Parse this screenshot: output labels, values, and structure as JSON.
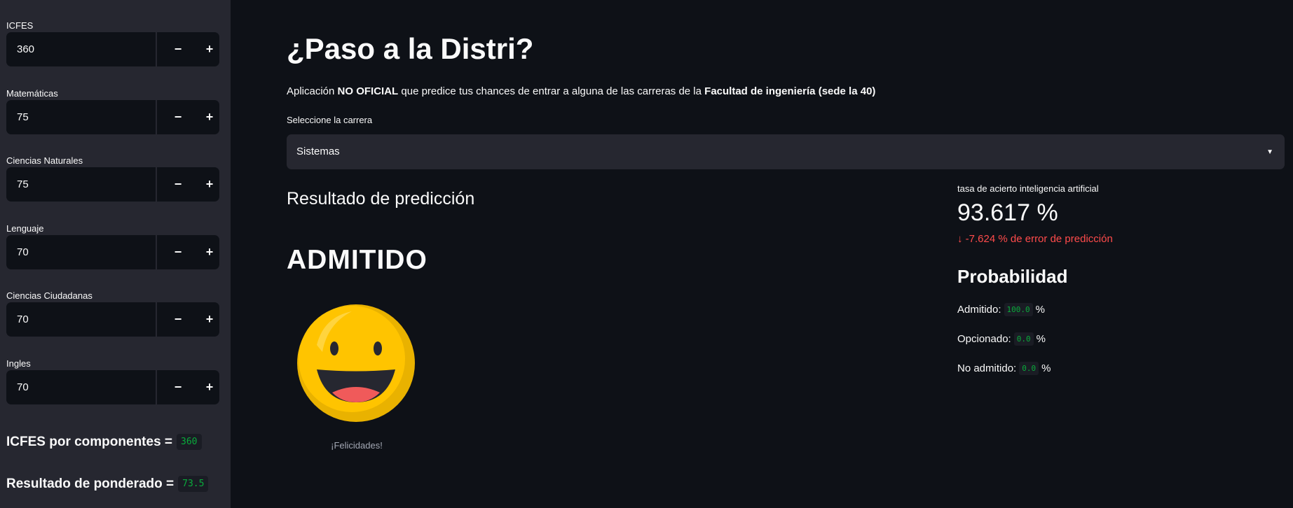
{
  "sidebar": {
    "fields": [
      {
        "label": "ICFES",
        "value": "360"
      },
      {
        "label": "Matemáticas",
        "value": "75"
      },
      {
        "label": "Ciencias Naturales",
        "value": "75"
      },
      {
        "label": "Lenguaje",
        "value": "70"
      },
      {
        "label": "Ciencias Ciudadanas",
        "value": "70"
      },
      {
        "label": "Ingles",
        "value": "70"
      }
    ],
    "step_minus": "−",
    "step_plus": "+",
    "icfes_components_label": "ICFES por componentes =",
    "icfes_components_value": "360",
    "weighted_label": "Resultado de ponderado =",
    "weighted_value": "73.5"
  },
  "main": {
    "title": "¿Paso a la Distri?",
    "subtitle_prefix": "Aplicación ",
    "subtitle_bold1": "NO OFICIAL",
    "subtitle_middle": " que predice tus chances de entrar a alguna de las carreras de la ",
    "subtitle_bold2": "Facultad de ingeniería (sede la 40)",
    "select_label": "Seleccione la carrera",
    "select_value": "Sistemas",
    "result_heading": "Resultado de predicción",
    "result": "ADMITIDO",
    "smiley_icon": "smiling-face-icon",
    "caption": "¡Felicidades!"
  },
  "metrics": {
    "label": "tasa de acierto inteligencia artificial",
    "value": "93.617 %",
    "delta": "-7.624 % de error de predicción",
    "delta_arrow": "↓",
    "delta_color": "#ff4b4b"
  },
  "probability": {
    "heading": "Probabilidad",
    "rows": [
      {
        "label": "Admitido:",
        "value": "100.0",
        "unit": "%"
      },
      {
        "label": "Opcionado:",
        "value": "0.0",
        "unit": "%"
      },
      {
        "label": "No admitido:",
        "value": "0.0",
        "unit": "%"
      }
    ]
  },
  "colors": {
    "background": "#0e1117",
    "sidebar": "#262730",
    "code_green": "#09ab3b",
    "smiley_yellow": "#ffc400"
  }
}
